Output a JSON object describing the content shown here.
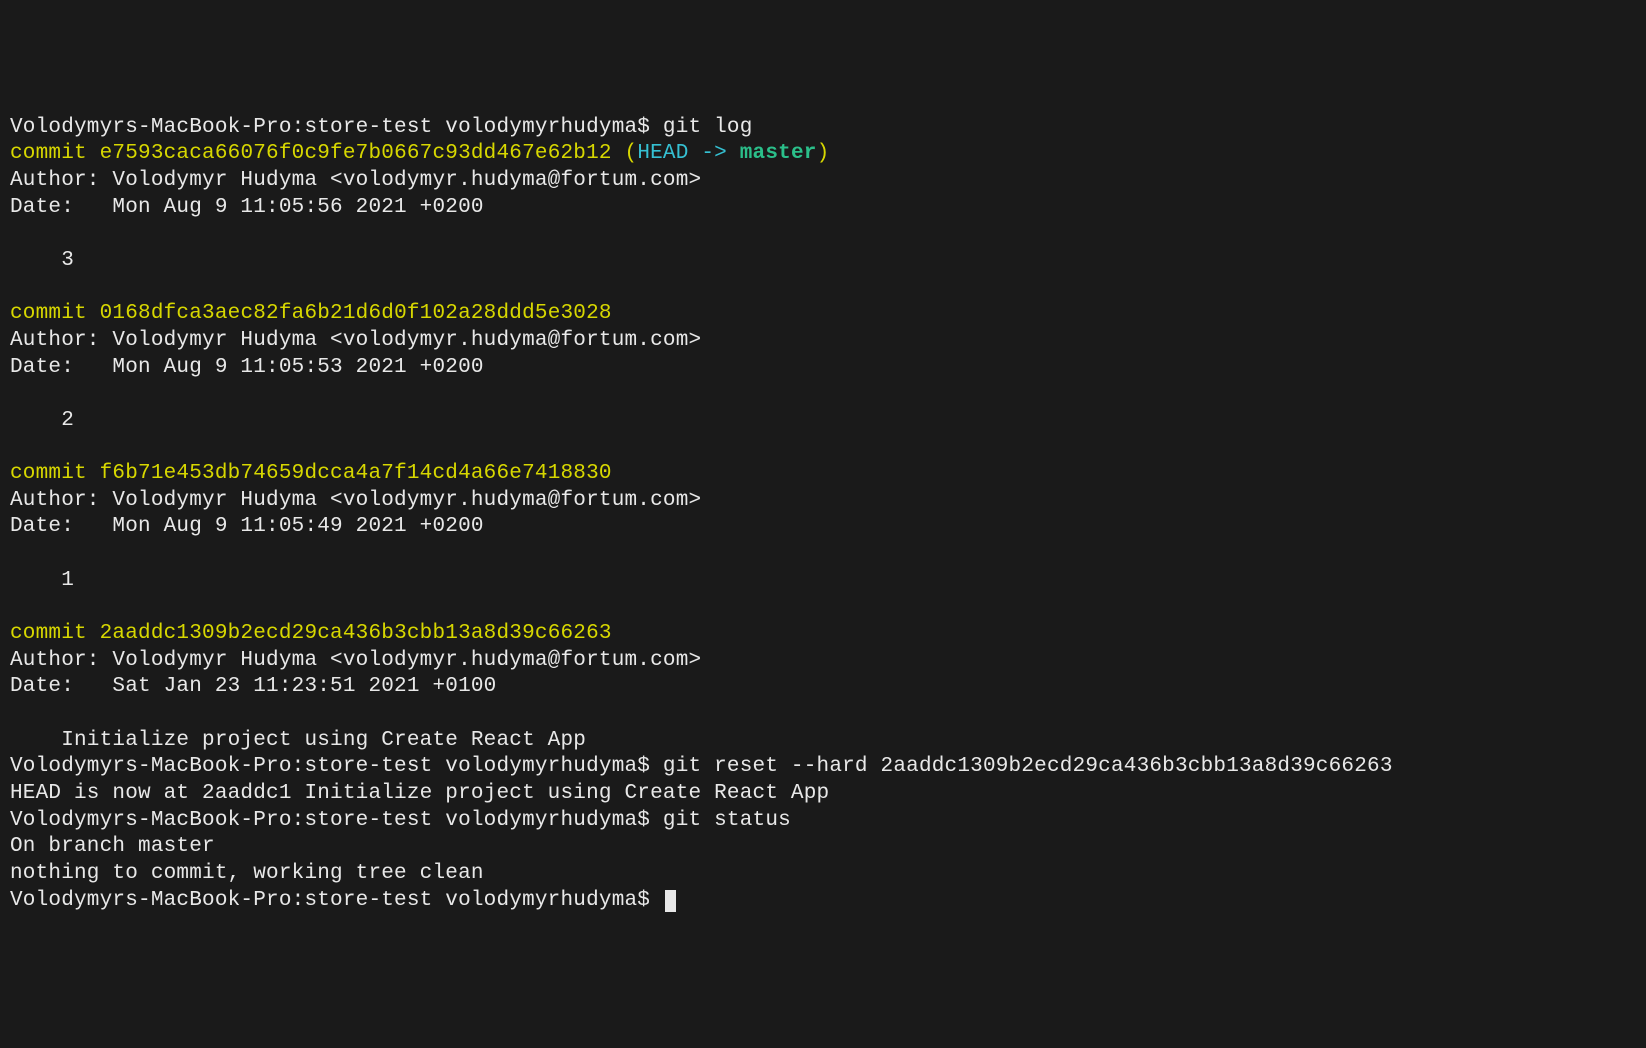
{
  "prompt": "Volodymyrs-MacBook-Pro:store-test volodymyrhudyma$ ",
  "commands": {
    "git_log": "git log",
    "git_reset": "git reset --hard 2aaddc1309b2ecd29ca436b3cbb13a8d39c66263",
    "git_status": "git status"
  },
  "commits": [
    {
      "hash": "e7593caca66076f0c9fe7b0667c93dd467e62b12",
      "ref_open": " (",
      "ref_head": "HEAD -> ",
      "ref_branch": "master",
      "ref_close": ")",
      "author": "Author: Volodymyr Hudyma <volodymyr.hudyma@fortum.com>",
      "date": "Date:   Mon Aug 9 11:05:56 2021 +0200",
      "message": "    3"
    },
    {
      "hash": "0168dfca3aec82fa6b21d6d0f102a28ddd5e3028",
      "author": "Author: Volodymyr Hudyma <volodymyr.hudyma@fortum.com>",
      "date": "Date:   Mon Aug 9 11:05:53 2021 +0200",
      "message": "    2"
    },
    {
      "hash": "f6b71e453db74659dcca4a7f14cd4a66e7418830",
      "author": "Author: Volodymyr Hudyma <volodymyr.hudyma@fortum.com>",
      "date": "Date:   Mon Aug 9 11:05:49 2021 +0200",
      "message": "    1"
    },
    {
      "hash": "2aaddc1309b2ecd29ca436b3cbb13a8d39c66263",
      "author": "Author: Volodymyr Hudyma <volodymyr.hudyma@fortum.com>",
      "date": "Date:   Sat Jan 23 11:23:51 2021 +0100",
      "message": "    Initialize project using Create React App"
    }
  ],
  "reset_output": "HEAD is now at 2aaddc1 Initialize project using Create React App",
  "status_output": {
    "line1": "On branch master",
    "line2": "nothing to commit, working tree clean"
  },
  "commit_prefix": "commit "
}
